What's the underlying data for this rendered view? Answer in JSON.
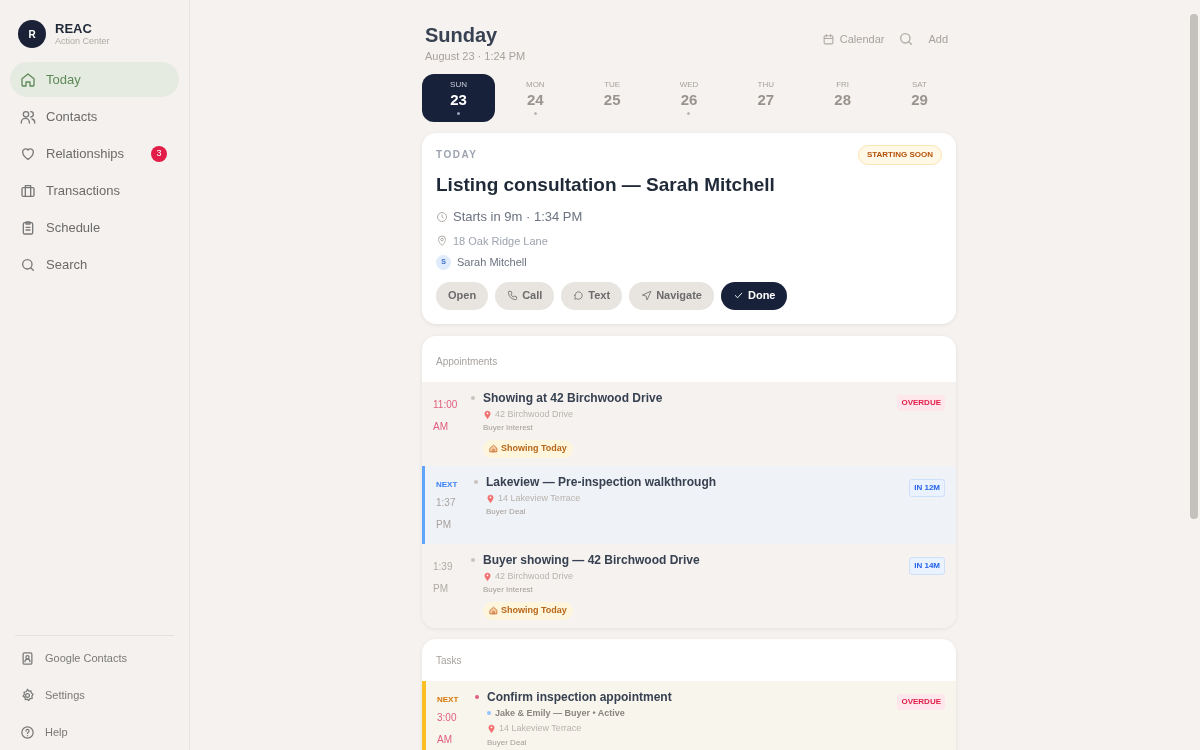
{
  "brand": {
    "avatar": "R",
    "name": "REAC",
    "subtitle": "Action Center"
  },
  "nav": [
    {
      "label": "Today",
      "selected": true
    },
    {
      "label": "Contacts",
      "selected": false
    },
    {
      "label": "Relationships",
      "selected": false,
      "badge": "3"
    },
    {
      "label": "Transactions",
      "selected": false
    },
    {
      "label": "Schedule",
      "selected": false
    },
    {
      "label": "Search",
      "selected": false
    }
  ],
  "footer_nav": [
    {
      "label": "Google Contacts"
    },
    {
      "label": "Settings"
    },
    {
      "label": "Help"
    }
  ],
  "header": {
    "title": "Sunday",
    "subtitle": "August 23 · 1:24 PM",
    "actions": [
      {
        "label": "Calendar",
        "kind": "calendar"
      },
      {
        "kind": "search"
      },
      {
        "label": "Add",
        "kind": "text"
      }
    ]
  },
  "days": [
    {
      "weekday": "SUN",
      "date": "23",
      "selected": true,
      "has_events": true
    },
    {
      "weekday": "MON",
      "date": "24",
      "selected": false,
      "has_events": true
    },
    {
      "weekday": "TUE",
      "date": "25",
      "selected": false,
      "has_events": false
    },
    {
      "weekday": "WED",
      "date": "26",
      "selected": false,
      "has_events": true
    },
    {
      "weekday": "THU",
      "date": "27",
      "selected": false,
      "has_events": false
    },
    {
      "weekday": "FRI",
      "date": "28",
      "selected": false,
      "has_events": false
    },
    {
      "weekday": "SAT",
      "date": "29",
      "selected": false,
      "has_events": false
    }
  ],
  "hero": {
    "eyebrow": "TODAY",
    "badge": "STARTING SOON",
    "title": "Listing consultation — Sarah Mitchell",
    "when": "Starts in 9m · 1:34 PM",
    "address": "18 Oak Ridge Lane",
    "contact_initial": "S",
    "contact": "Sarah Mitchell",
    "buttons": [
      {
        "label": "Open",
        "kind": "plain"
      },
      {
        "label": "Call",
        "kind": "call"
      },
      {
        "label": "Text",
        "kind": "text"
      },
      {
        "label": "Navigate",
        "kind": "navigate"
      },
      {
        "label": "Done",
        "kind": "primary"
      }
    ]
  },
  "appointments": {
    "title": "Appointments",
    "items": [
      {
        "kind": "overdue",
        "time": "11:00 AM",
        "title": "Showing at 42 Birchwood Drive",
        "address": "42 Birchwood Drive",
        "category": "Buyer Interest",
        "tag": "Showing Today",
        "badge": "OVERDUE"
      },
      {
        "kind": "next",
        "label": "NEXT",
        "time": "1:37 PM",
        "title": "Lakeview — Pre-inspection walkthrough",
        "address": "14 Lakeview Terrace",
        "category": "Buyer Deal",
        "badge": "IN 12M"
      },
      {
        "kind": "upcoming",
        "time": "1:39 PM",
        "title": "Buyer showing — 42 Birchwood Drive",
        "address": "42 Birchwood Drive",
        "category": "Buyer Interest",
        "tag": "Showing Today",
        "badge": "IN 14M"
      }
    ]
  },
  "tasks": {
    "title": "Tasks",
    "items": [
      {
        "kind": "overdue",
        "label": "NEXT",
        "time": "3:00 AM",
        "title": "Confirm inspection appointment",
        "contact": "Jake & Emily — Buyer • Active",
        "address": "14 Lakeview Terrace",
        "category": "Buyer Deal",
        "badge": "OVERDUE"
      }
    ]
  }
}
